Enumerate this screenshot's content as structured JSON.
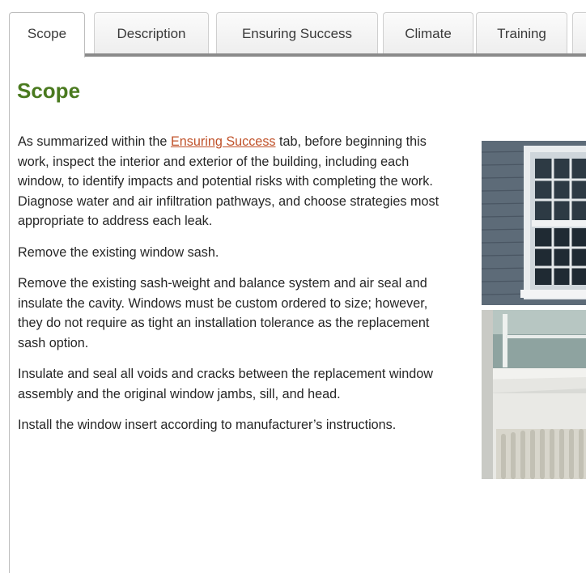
{
  "tabs": [
    {
      "label": "Scope",
      "active": true
    },
    {
      "label": "Description",
      "active": false
    },
    {
      "label": "Ensuring Success",
      "active": false
    },
    {
      "label": "Climate",
      "active": false
    },
    {
      "label": "Training",
      "active": false
    }
  ],
  "heading": "Scope",
  "paragraphs": {
    "p1_before": "As summarized within the ",
    "p1_link": "Ensuring Success",
    "p1_after": " tab, before beginning this work, inspect the interior and exterior of the building, including each window, to identify impacts and potential risks with completing the work. Diagnose water and air infiltration pathways, and choose strategies most appropriate to address each leak.",
    "p2": "Remove the existing window sash.",
    "p3": "Remove the existing sash-weight and balance system and air seal and insulate the cavity.  Windows must be custom ordered to size; however, they do not require as tight an installation tolerance as the replacement sash option.",
    "p4": "Insulate and seal all voids and cracks between the replacement window assembly and the original window jambs, sill, and head.",
    "p5": "Install the window insert according to manufacturer’s instructions."
  },
  "colors": {
    "heading": "#4a7a1f",
    "link": "#c0522a",
    "text": "#262626"
  }
}
